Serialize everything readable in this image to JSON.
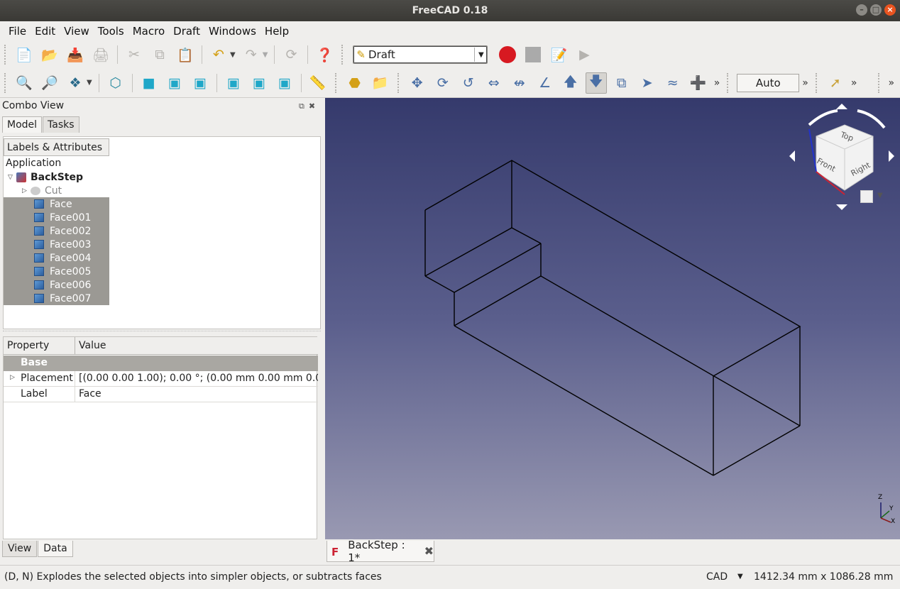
{
  "window": {
    "title": "FreeCAD 0.18"
  },
  "menubar": {
    "items": [
      "File",
      "Edit",
      "View",
      "Tools",
      "Macro",
      "Draft",
      "Windows",
      "Help"
    ]
  },
  "toolbar": {
    "workbench": "Draft",
    "snap_mode": "Auto",
    "overflow": "»"
  },
  "combo": {
    "title": "Combo View",
    "tabs": [
      "Model",
      "Tasks"
    ],
    "tree": {
      "header": "Labels & Attributes",
      "root": "Application",
      "document": "BackStep",
      "cut": "Cut",
      "faces": [
        "Face",
        "Face001",
        "Face002",
        "Face003",
        "Face004",
        "Face005",
        "Face006",
        "Face007"
      ]
    },
    "props": {
      "col_property": "Property",
      "col_value": "Value",
      "group": "Base",
      "placement_key": "Placement",
      "placement_value": "[(0.00 0.00 1.00); 0.00 °; (0.00 mm  0.00 mm  0.0...",
      "label_key": "Label",
      "label_value": "Face"
    },
    "bottom_tabs": [
      "View",
      "Data"
    ]
  },
  "viewcube": {
    "top": "Top",
    "front": "Front",
    "right": "Right",
    "axes": [
      "X",
      "Y",
      "Z"
    ]
  },
  "doc_tab": {
    "label": "BackStep : 1*"
  },
  "status": {
    "message": "(D, N) Explodes the selected objects into simpler objects, or subtracts faces",
    "nav_style": "CAD",
    "dimensions": "1412.34 mm x 1086.28 mm"
  },
  "colors": {
    "viewport_top": "#353a6c",
    "viewport_bottom": "#9999b2",
    "selection": "#9b9994",
    "record": "#d71921"
  }
}
